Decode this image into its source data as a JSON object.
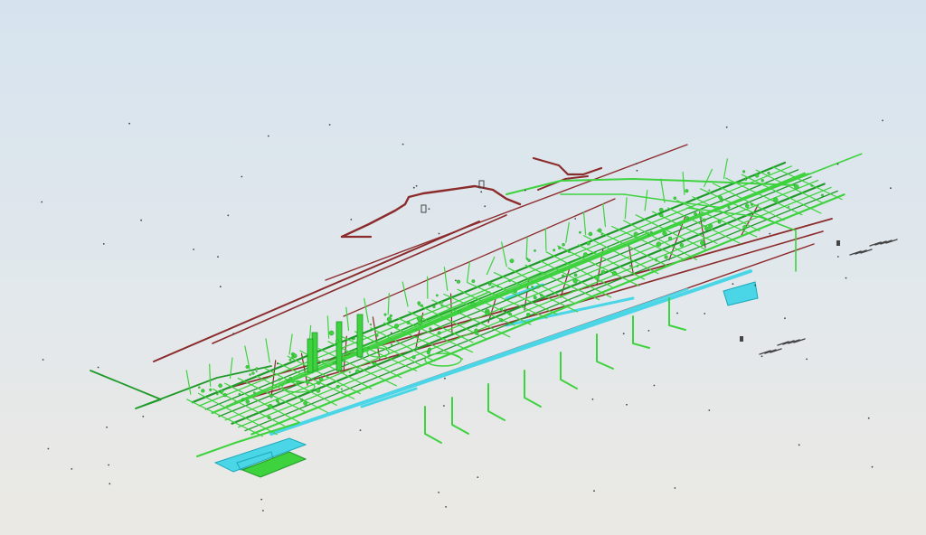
{
  "viewport": {
    "background_top": "#d6e3ee",
    "background_bottom": "#ebe9e3"
  },
  "colors": {
    "supply_pipe": "#3ed23e",
    "supply_pipe_dark": "#1f9a2a",
    "return_pipe": "#8b2b2b",
    "duct": "#4ad6e6",
    "duct_dark": "#1aa7b8",
    "fixture": "#444444"
  },
  "layers": [
    "green-pipes",
    "red-pipes",
    "cyan-ducts",
    "fixtures"
  ]
}
